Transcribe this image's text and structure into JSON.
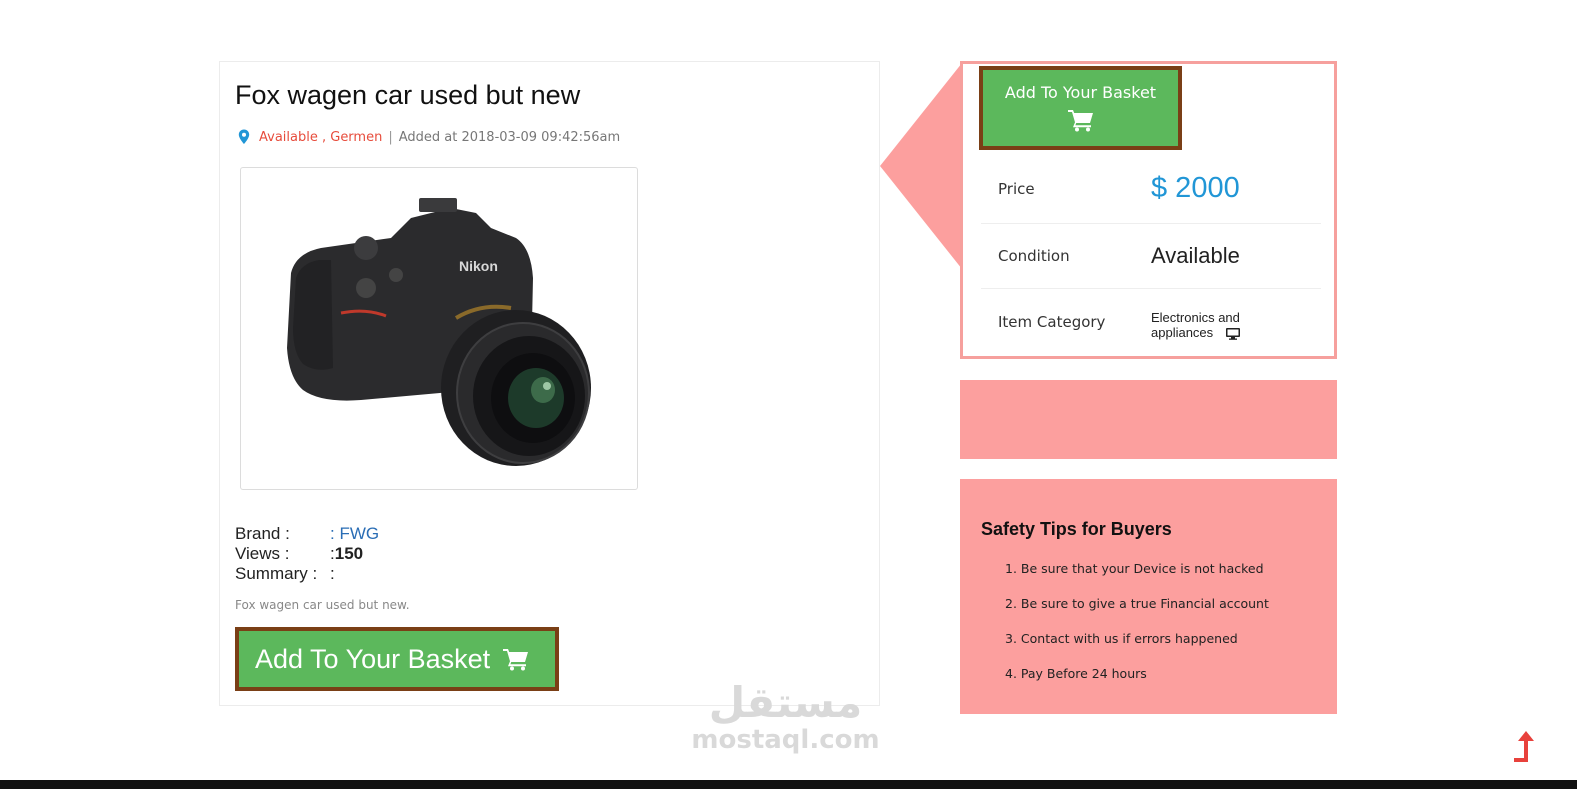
{
  "product": {
    "title": "Fox wagen car used but new",
    "location_status": "Available , Germen",
    "separator": "|",
    "added_at": "Added  at  2018-03-09  09:42:56am",
    "brand_key": "Brand :",
    "brand_value": ": FWG",
    "views_key": "Views :",
    "views_colon": ": ",
    "views_value": "150",
    "summary_key": "Summary :",
    "summary_colon": ":",
    "summary_text": "Fox  wagen  car  used  but  new.",
    "basket_label": "Add To Your Basket",
    "image_brand": "Nikon"
  },
  "price_panel": {
    "basket_label": "Add To Your Basket",
    "price_label": "Price",
    "price_value": "$ 2000",
    "condition_label": "Condition",
    "condition_value": "Available",
    "category_label": "Item Category",
    "category_line1": "Electronics and",
    "category_line2": "appliances"
  },
  "safety": {
    "title": "Safety Tips for Buyers",
    "tips": [
      "1. Be sure that your Device is not hacked",
      "2. Be sure to give a true Financial account",
      "3. Contact with us if errors happened",
      "4. Pay Before 24 hours"
    ]
  },
  "watermark": {
    "arabic": "مستقل",
    "latin": "mostaql.com"
  },
  "colors": {
    "accent_green": "#5cb85c",
    "border_brown": "#7a3f16",
    "pink": "#fc9f9e",
    "price_blue": "#2196d6",
    "location_red": "#e74c3c"
  },
  "icons": {
    "location": "map-pin-icon",
    "cart": "shopping-cart-icon",
    "monitor": "desktop-monitor-icon",
    "scroll_top": "arrow-up-icon"
  }
}
